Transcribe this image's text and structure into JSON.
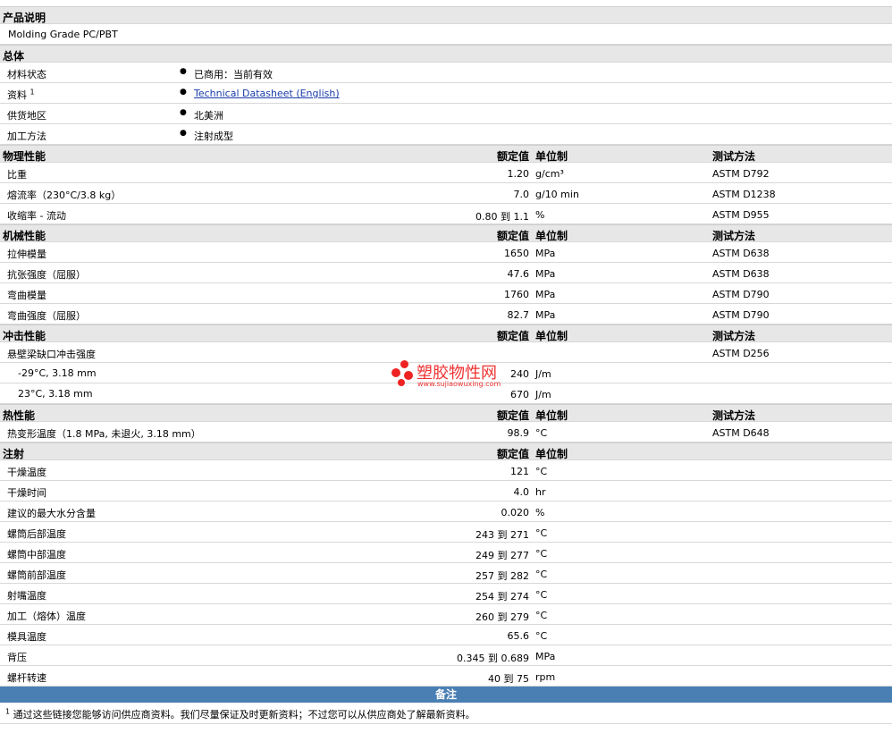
{
  "product": {
    "title": "产品说明",
    "description": "Molding Grade PC/PBT"
  },
  "general": {
    "title": "总体",
    "rows": [
      {
        "label": "材料状态",
        "value": "已商用：当前有效"
      },
      {
        "label": "资料",
        "sup": "1",
        "value": "Technical Datasheet (English)",
        "is_link": true
      },
      {
        "label": "供货地区",
        "value": "北美洲"
      },
      {
        "label": "加工方法",
        "value": "注射成型"
      }
    ]
  },
  "headers": {
    "nominal": "额定值",
    "unit": "单位制",
    "method": "测试方法"
  },
  "physical": {
    "title": "物理性能",
    "rows": [
      {
        "label": "比重",
        "value": "1.20",
        "unit": "g/cm³",
        "method": "ASTM D792"
      },
      {
        "label": "熔流率（230°C/3.8 kg）",
        "value": "7.0",
        "unit": "g/10 min",
        "method": "ASTM D1238"
      },
      {
        "label": "收缩率 - 流动",
        "value": "0.80 到  1.1",
        "unit": "%",
        "method": "ASTM D955"
      }
    ]
  },
  "mechanical": {
    "title": "机械性能",
    "rows": [
      {
        "label": "拉伸模量",
        "value": "1650",
        "unit": "MPa",
        "method": "ASTM D638"
      },
      {
        "label": "抗张强度（屈服）",
        "value": "47.6",
        "unit": "MPa",
        "method": "ASTM D638"
      },
      {
        "label": "弯曲模量",
        "value": "1760",
        "unit": "MPa",
        "method": "ASTM D790"
      },
      {
        "label": "弯曲强度（屈服）",
        "value": "82.7",
        "unit": "MPa",
        "method": "ASTM D790"
      }
    ]
  },
  "impact": {
    "title": "冲击性能",
    "rows": [
      {
        "label": "悬壁梁缺口冲击强度",
        "value": "",
        "unit": "",
        "method": "ASTM D256",
        "indent": false
      },
      {
        "label": "-29°C, 3.18 mm",
        "value": "240",
        "unit": "J/m",
        "method": "",
        "indent": true
      },
      {
        "label": "23°C, 3.18 mm",
        "value": "670",
        "unit": "J/m",
        "method": "",
        "indent": true
      }
    ]
  },
  "thermal": {
    "title": "热性能",
    "rows": [
      {
        "label": "热变形温度（1.8 MPa, 未退火, 3.18 mm）",
        "value": "98.9",
        "unit": "°C",
        "method": "ASTM D648"
      }
    ]
  },
  "injection": {
    "title": "注射",
    "rows": [
      {
        "label": "干燥温度",
        "value": "121",
        "unit": "°C"
      },
      {
        "label": "干燥时间",
        "value": "4.0",
        "unit": "hr"
      },
      {
        "label": "建议的最大水分含量",
        "value": "0.020",
        "unit": "%"
      },
      {
        "label": "螺筒后部温度",
        "value": "243 到  271",
        "unit": "°C"
      },
      {
        "label": "螺筒中部温度",
        "value": "249 到  277",
        "unit": "°C"
      },
      {
        "label": "螺筒前部温度",
        "value": "257 到  282",
        "unit": "°C"
      },
      {
        "label": "射嘴温度",
        "value": "254 到  274",
        "unit": "°C"
      },
      {
        "label": "加工（熔体）温度",
        "value": "260 到  279",
        "unit": "°C"
      },
      {
        "label": "模具温度",
        "value": "65.6",
        "unit": "°C"
      },
      {
        "label": "背压",
        "value": "0.345 到  0.689",
        "unit": "MPa"
      },
      {
        "label": "螺杆转速",
        "value": "40 到  75",
        "unit": "rpm"
      }
    ]
  },
  "notes": {
    "title": "备注",
    "footnote_num": "1",
    "footnote": "通过这些链接您能够访问供应商资料。我们尽量保证及时更新资料；不过您可以从供应商处了解最新资料。"
  },
  "watermark": {
    "name": "塑胶物性网",
    "url": "www.sujiaowuxing.com"
  },
  "colors": {
    "section_bg": "#e7e7e7",
    "notes_bg": "#4a7fb3",
    "link": "#1a3caa",
    "watermark": "#e33"
  }
}
